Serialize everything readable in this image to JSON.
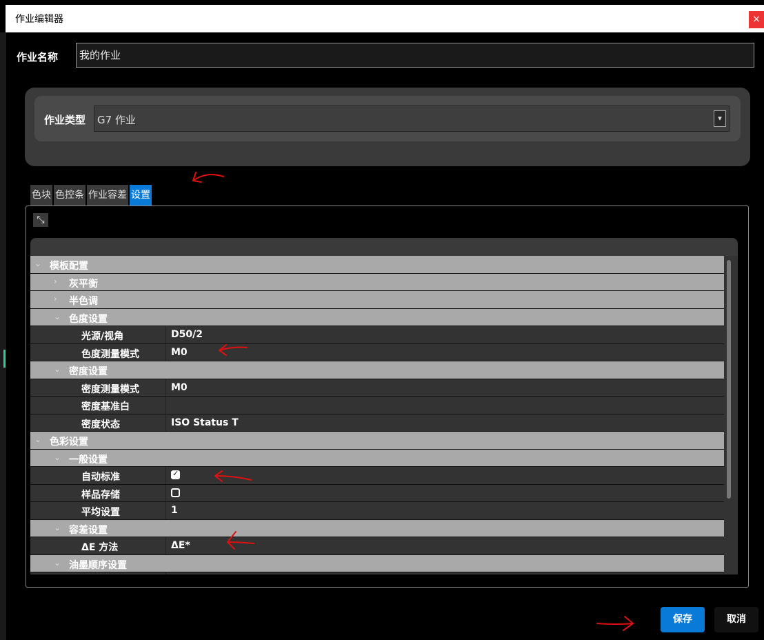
{
  "window": {
    "title": "作业编辑器",
    "close_label": "×"
  },
  "job_name": {
    "label": "作业名称",
    "value": "我的作业"
  },
  "job_type": {
    "label": "作业类型",
    "value": "G7 作业"
  },
  "tabs": [
    {
      "label": "色块",
      "active": false
    },
    {
      "label": "色控条",
      "active": false
    },
    {
      "label": "作业容差",
      "active": false
    },
    {
      "label": "设置",
      "active": true
    }
  ],
  "tree": [
    {
      "kind": "cat",
      "level": 0,
      "expanded": true,
      "label": "模板配置"
    },
    {
      "kind": "cat",
      "level": 1,
      "expanded": false,
      "label": "灰平衡"
    },
    {
      "kind": "cat",
      "level": 1,
      "expanded": false,
      "label": "半色调"
    },
    {
      "kind": "cat",
      "level": 1,
      "expanded": true,
      "label": "色度设置"
    },
    {
      "kind": "prop",
      "label": "光源/视角",
      "value": "D50/2"
    },
    {
      "kind": "prop",
      "label": "色度测量模式",
      "value": "M0"
    },
    {
      "kind": "cat",
      "level": 1,
      "expanded": true,
      "label": "密度设置"
    },
    {
      "kind": "prop",
      "label": "密度测量模式",
      "value": "M0"
    },
    {
      "kind": "prop",
      "label": "密度基准白",
      "value": ""
    },
    {
      "kind": "prop",
      "label": "密度状态",
      "value": "ISO Status T"
    },
    {
      "kind": "cat",
      "level": 0,
      "expanded": true,
      "label": "色彩设置"
    },
    {
      "kind": "cat",
      "level": 1,
      "expanded": true,
      "label": "一般设置"
    },
    {
      "kind": "check",
      "label": "自动标准",
      "checked": true
    },
    {
      "kind": "check",
      "label": "样品存储",
      "checked": false
    },
    {
      "kind": "prop",
      "label": "平均设置",
      "value": "1"
    },
    {
      "kind": "cat",
      "level": 1,
      "expanded": true,
      "label": "容差设置"
    },
    {
      "kind": "prop",
      "label": "ΔE 方法",
      "value": "ΔE*"
    },
    {
      "kind": "cat",
      "level": 1,
      "expanded": true,
      "label": "油墨顺序设置"
    },
    {
      "kind": "prop",
      "label": "",
      "value": ""
    }
  ],
  "buttons": {
    "save": "保存",
    "cancel": "取消"
  },
  "colors": {
    "accent": "#0a7ad8",
    "annotation": "#e01010",
    "category_row": "#a9a9a9",
    "property_row": "#333333"
  }
}
